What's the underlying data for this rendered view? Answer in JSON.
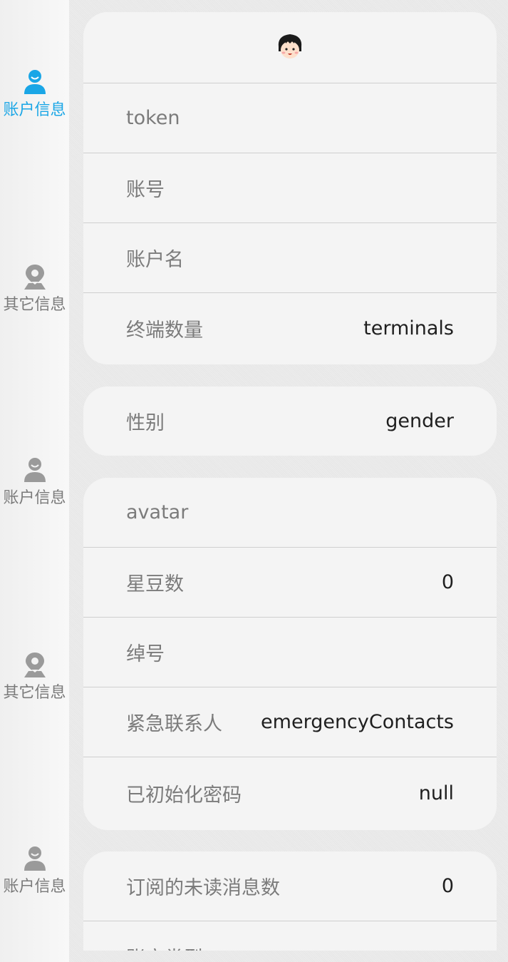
{
  "sidebar": {
    "items": [
      {
        "label": "账户信息",
        "icon": "user-icon",
        "active": true
      },
      {
        "label": "其它信息",
        "icon": "location-pin-icon",
        "active": false
      },
      {
        "label": "账户信息",
        "icon": "user-icon",
        "active": false
      },
      {
        "label": "其它信息",
        "icon": "location-pin-icon",
        "active": false
      },
      {
        "label": "账户信息",
        "icon": "user-icon",
        "active": false
      }
    ]
  },
  "colors": {
    "accent": "#1aa6e6",
    "inactive": "#9a9a9a"
  },
  "card1": {
    "avatar_icon": "cartoon-girl-avatar-icon",
    "rows": [
      {
        "label": "token",
        "value": ""
      },
      {
        "label": "账号",
        "value": ""
      },
      {
        "label": "账户名",
        "value": ""
      },
      {
        "label": "终端数量",
        "value": "terminals"
      }
    ]
  },
  "card2": {
    "rows": [
      {
        "label": "性别",
        "value": "gender"
      }
    ]
  },
  "card3": {
    "rows": [
      {
        "label": "avatar",
        "value": ""
      },
      {
        "label": "星豆数",
        "value": "0"
      },
      {
        "label": "绰号",
        "value": ""
      },
      {
        "label": "紧急联系人",
        "value": "emergencyContacts"
      },
      {
        "label": "已初始化密码",
        "value": "null"
      }
    ]
  },
  "card4": {
    "rows": [
      {
        "label": "订阅的未读消息数",
        "value": "0"
      },
      {
        "label": "账户类型",
        "value": ""
      }
    ]
  }
}
